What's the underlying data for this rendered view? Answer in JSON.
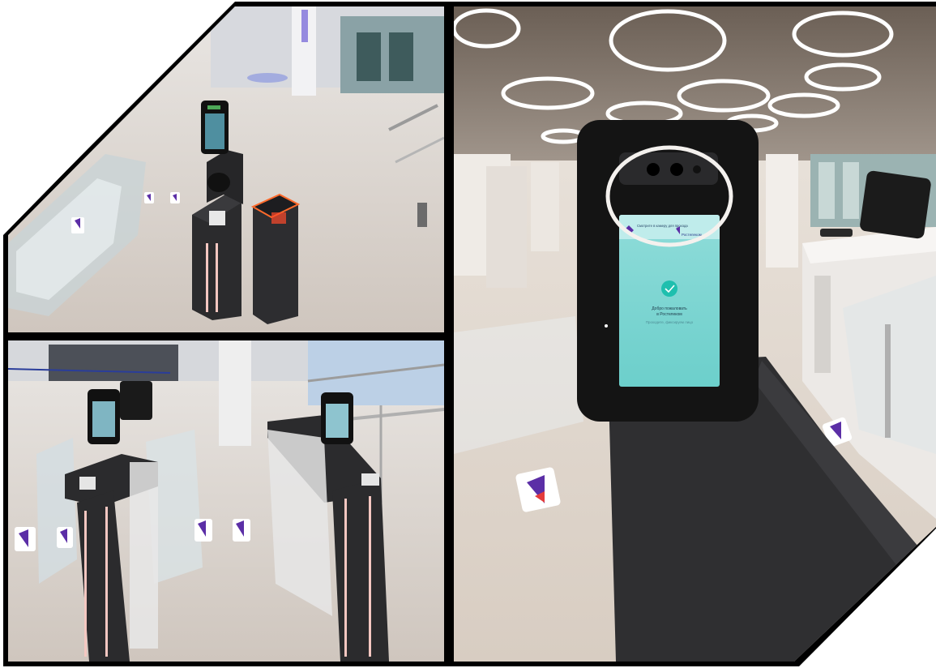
{
  "collage": {
    "panels": [
      {
        "id": "top-left",
        "subject": "turnstile-with-face-terminal"
      },
      {
        "id": "bottom-left",
        "subject": "two-turnstile-gates"
      },
      {
        "id": "right",
        "subject": "face-recognition-terminal-closeup"
      }
    ]
  },
  "terminal_screen": {
    "welcome_line1": "Добро пожаловать",
    "welcome_line2": "в Ростелеком",
    "prompt": "Проходите, фиксируем лицо",
    "brand": "Ростелеком",
    "header_text": "Смотрите в камеру для прохода"
  },
  "colors": {
    "frame": "#000000",
    "background": "#ffffff",
    "floor": "#dcd3ca",
    "gate_body": "#2b2b2d",
    "led_strip": "#f4c7c1",
    "screen": "#7fd6d3",
    "accent_orange": "#ff6a2b",
    "brand_purple": "#5b2ea6",
    "brand_red": "#e43b3b"
  },
  "icons": [
    "rostelecom-logo-icon",
    "check-circle-icon",
    "ceiling-ring-light-icon"
  ]
}
